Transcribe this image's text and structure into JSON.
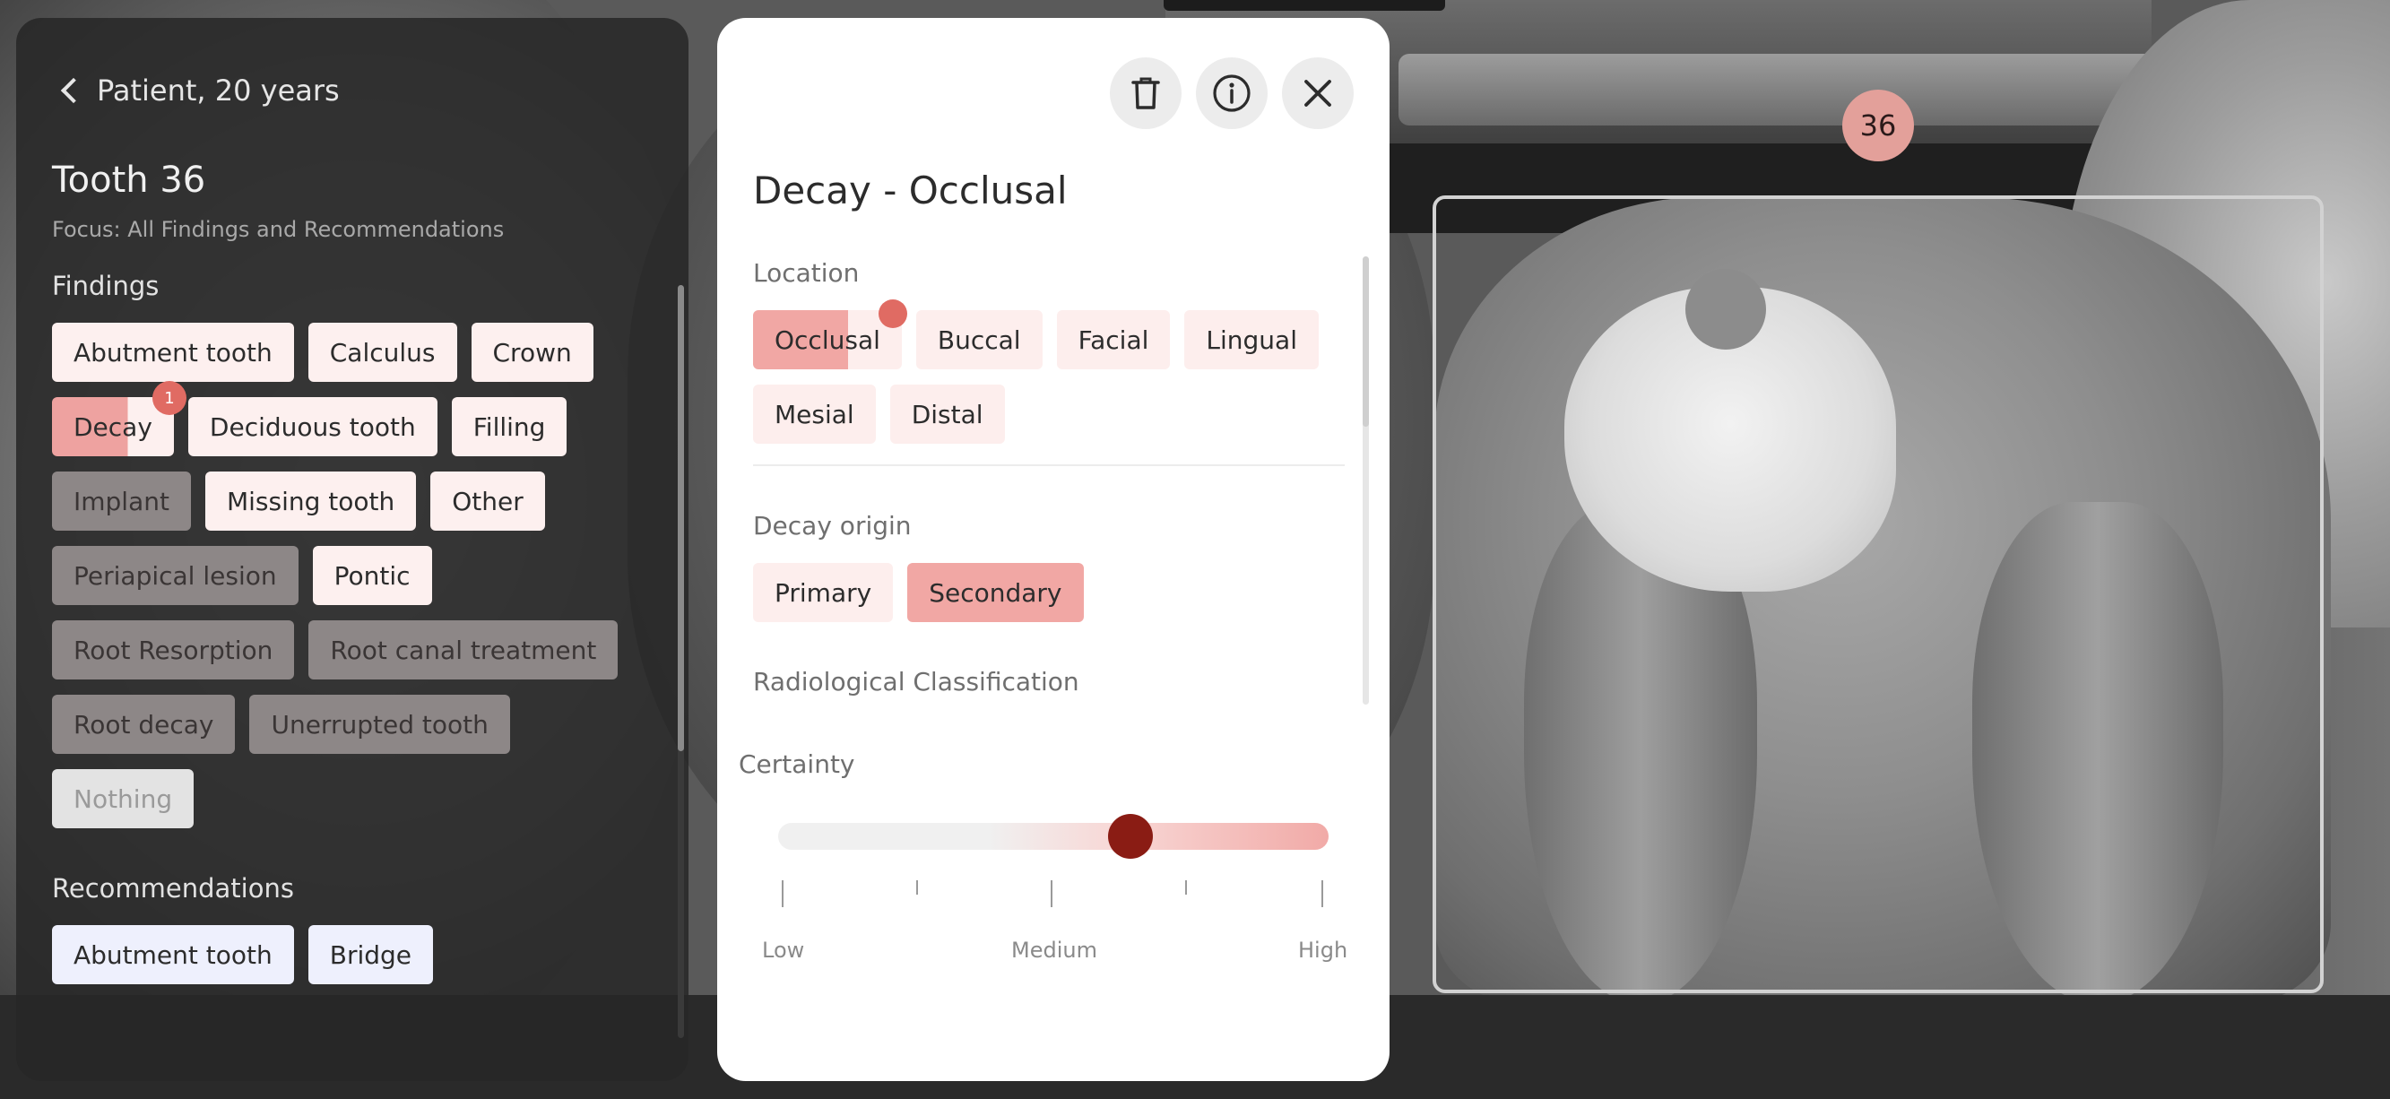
{
  "xray": {
    "tooth_badge": "36"
  },
  "sidebar": {
    "back_label": "Patient, 20 years",
    "tooth_title": "Tooth 36",
    "focus": "Focus: All Findings and Recommendations",
    "findings_label": "Findings",
    "findings": [
      {
        "label": "Abutment tooth",
        "state": "light"
      },
      {
        "label": "Calculus",
        "state": "light"
      },
      {
        "label": "Crown",
        "state": "light"
      },
      {
        "label": "Decay",
        "state": "decay",
        "badge": "1"
      },
      {
        "label": "Deciduous tooth",
        "state": "light"
      },
      {
        "label": "Filling",
        "state": "light"
      },
      {
        "label": "Implant",
        "state": "dark"
      },
      {
        "label": "Missing tooth",
        "state": "light"
      },
      {
        "label": "Other",
        "state": "light"
      },
      {
        "label": "Periapical lesion",
        "state": "dark"
      },
      {
        "label": "Pontic",
        "state": "light"
      },
      {
        "label": "Root Resorption",
        "state": "dark"
      },
      {
        "label": "Root canal treatment",
        "state": "dark"
      },
      {
        "label": "Root decay",
        "state": "dark"
      },
      {
        "label": "Unerrupted tooth",
        "state": "dark"
      },
      {
        "label": "Nothing",
        "state": "faded"
      }
    ],
    "recommendations_label": "Recommendations",
    "recommendations": [
      {
        "label": "Abutment tooth"
      },
      {
        "label": "Bridge"
      }
    ]
  },
  "modal": {
    "title": "Decay  - Occlusal",
    "delete_icon": "trash-icon",
    "info_icon": "info-icon",
    "close_icon": "close-icon",
    "location_label": "Location",
    "locations": [
      {
        "label": "Occlusal",
        "state": "partial",
        "dot": true
      },
      {
        "label": "Buccal",
        "state": "light"
      },
      {
        "label": "Facial",
        "state": "light"
      },
      {
        "label": "Lingual",
        "state": "light"
      },
      {
        "label": "Mesial",
        "state": "light"
      },
      {
        "label": "Distal",
        "state": "light"
      }
    ],
    "origin_label": "Decay origin",
    "origins": [
      {
        "label": "Primary",
        "state": "light"
      },
      {
        "label": "Secondary",
        "state": "selected"
      }
    ],
    "radiological_label": "Radiological Classification",
    "certainty": {
      "label": "Certainty",
      "value": 0.64,
      "low": "Low",
      "medium": "Medium",
      "high": "High"
    }
  },
  "colors": {
    "accent": "#e06b63",
    "selected_chip": "#f1a7a4",
    "slider_thumb": "#8a1c14",
    "badge": "#e3a09a"
  }
}
